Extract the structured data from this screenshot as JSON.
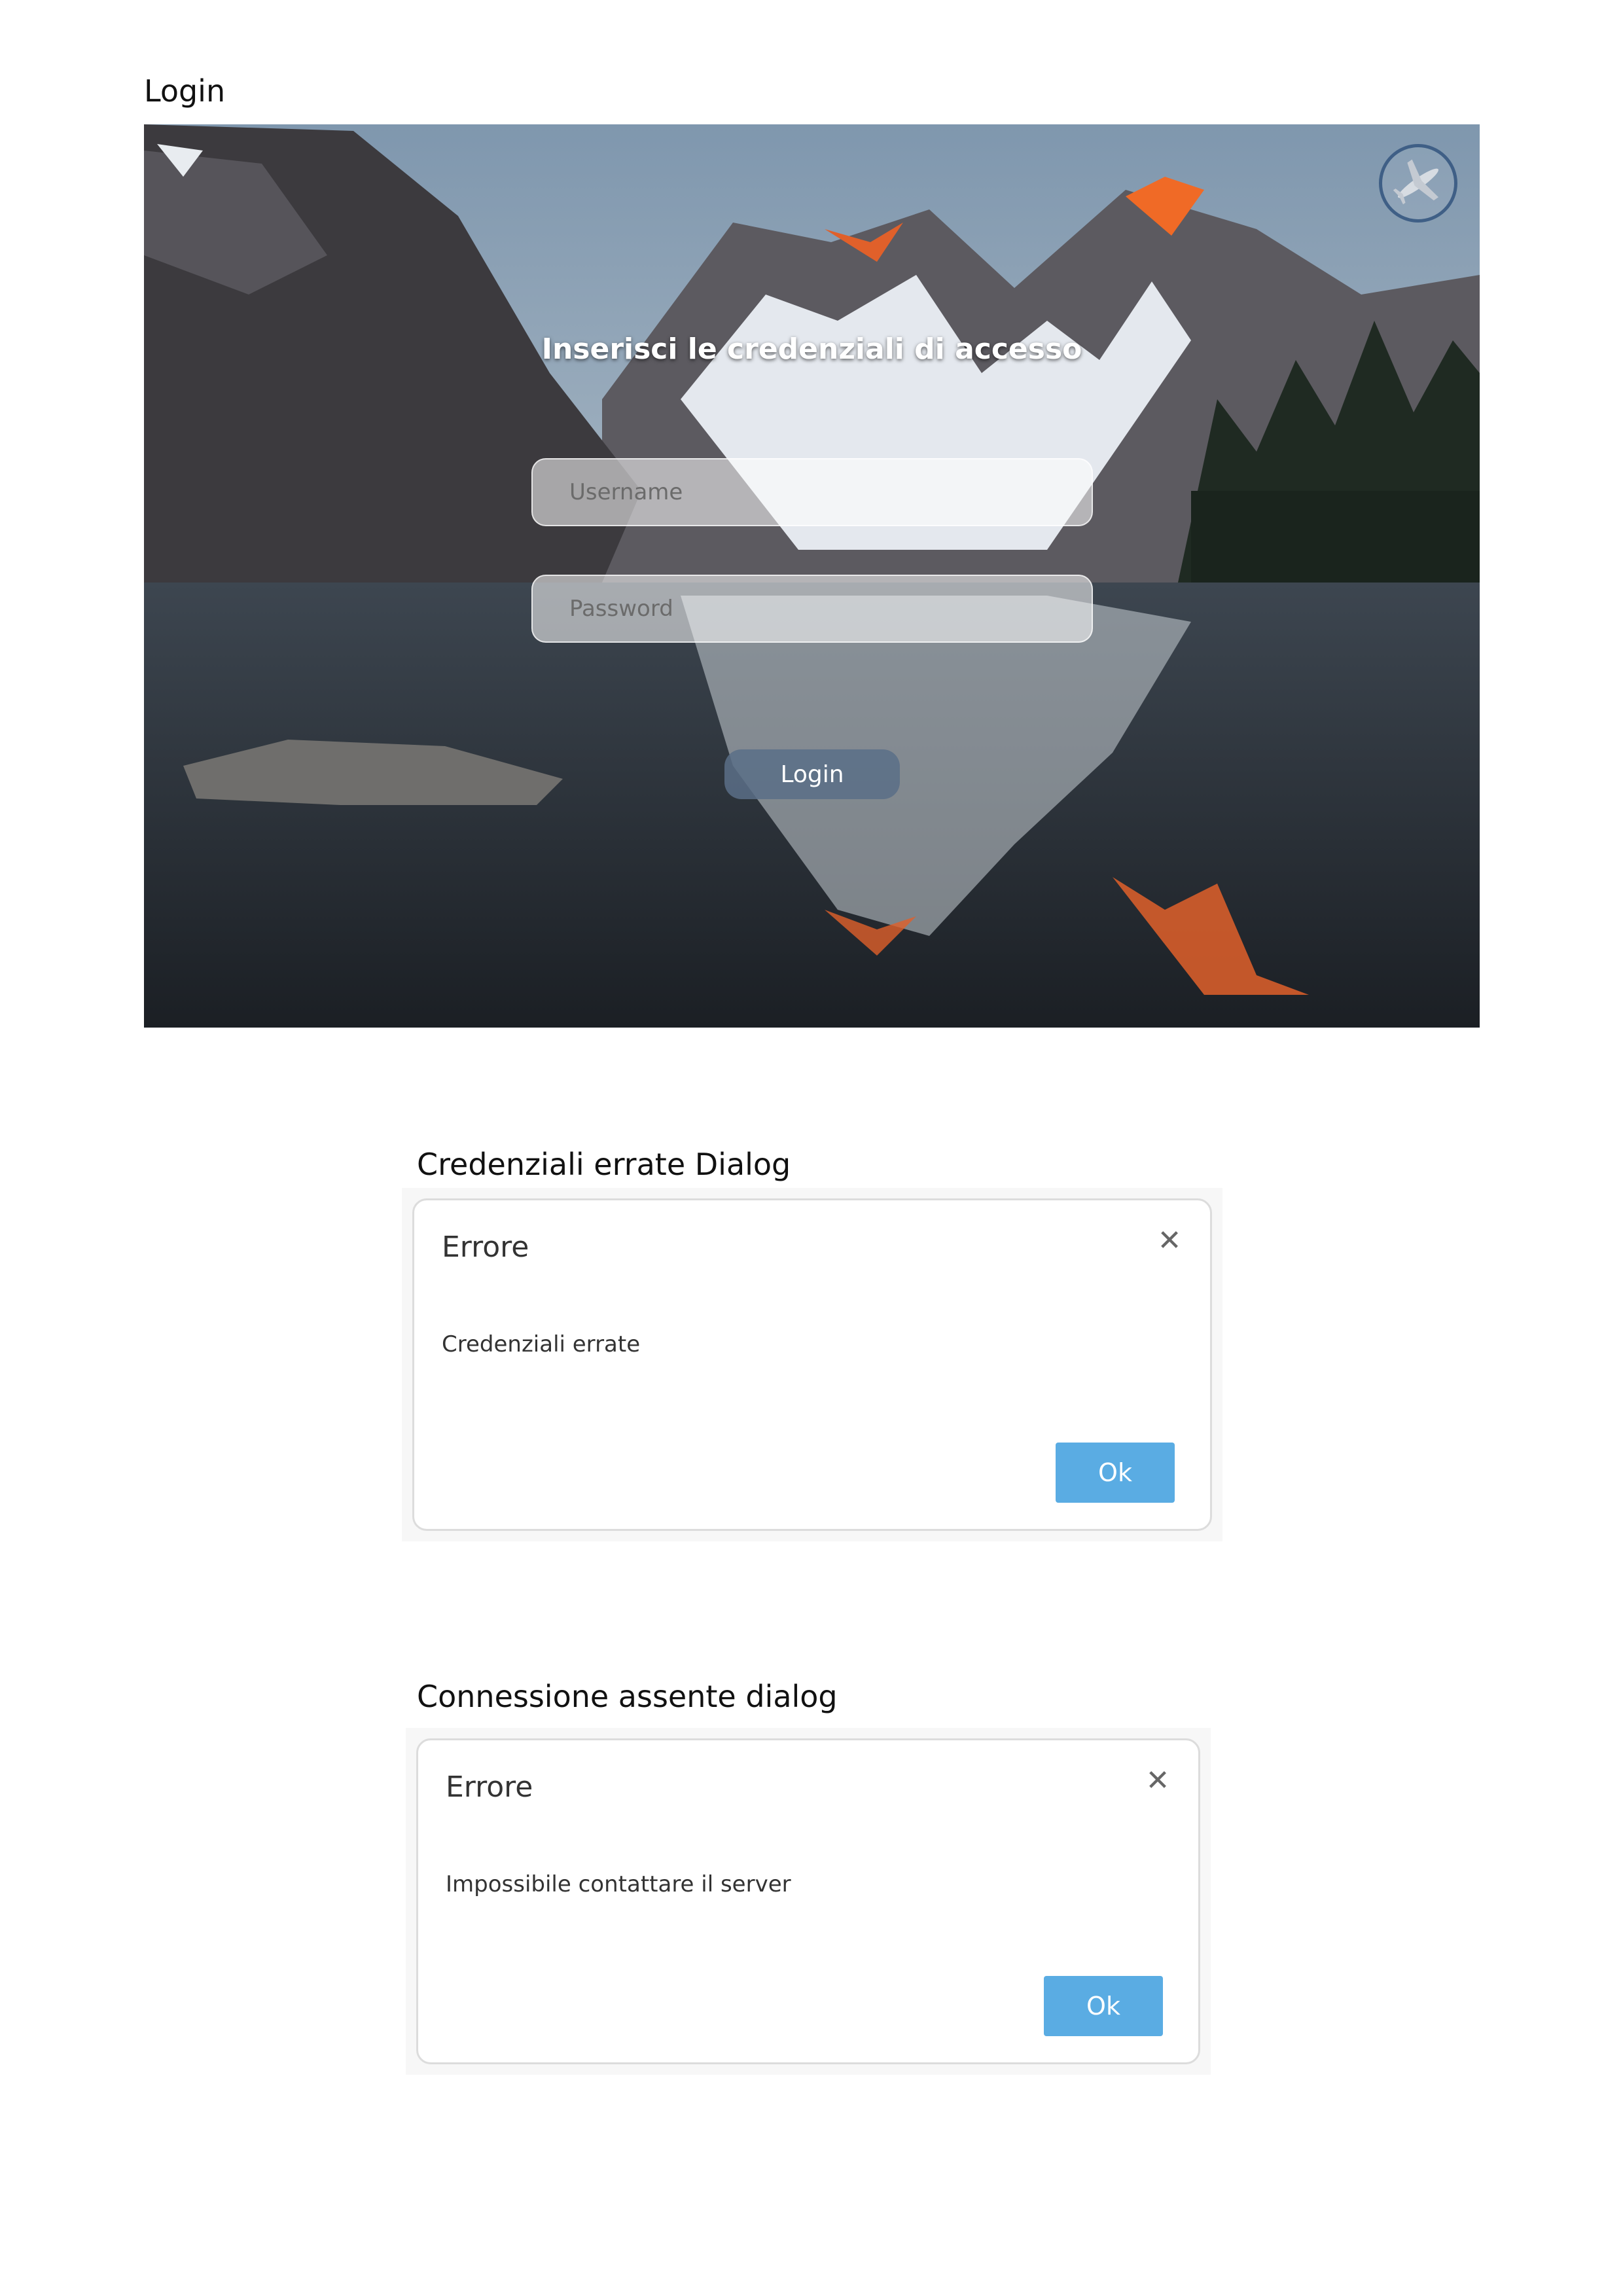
{
  "sections": {
    "login_title": "Login",
    "credentials_dialog_title": "Credenziali errate Dialog",
    "connection_dialog_title": "Connessione assente dialog"
  },
  "login": {
    "heading": "Inserisci le credenziali di accesso",
    "username_placeholder": "Username",
    "password_placeholder": "Password",
    "login_button": "Login",
    "logo_icon": "airplane-icon"
  },
  "dialogs": {
    "credentials": {
      "title": "Errore",
      "close_icon": "close-icon",
      "message": "Credenziali errate",
      "ok_label": "Ok"
    },
    "connection": {
      "title": "Errore",
      "close_icon": "close-icon",
      "message": "Impossibile contattare il server",
      "ok_label": "Ok"
    }
  },
  "colors": {
    "ok_button": "#5aace3",
    "login_button": "#5a6e87",
    "logo_ring": "#3f5f86"
  }
}
